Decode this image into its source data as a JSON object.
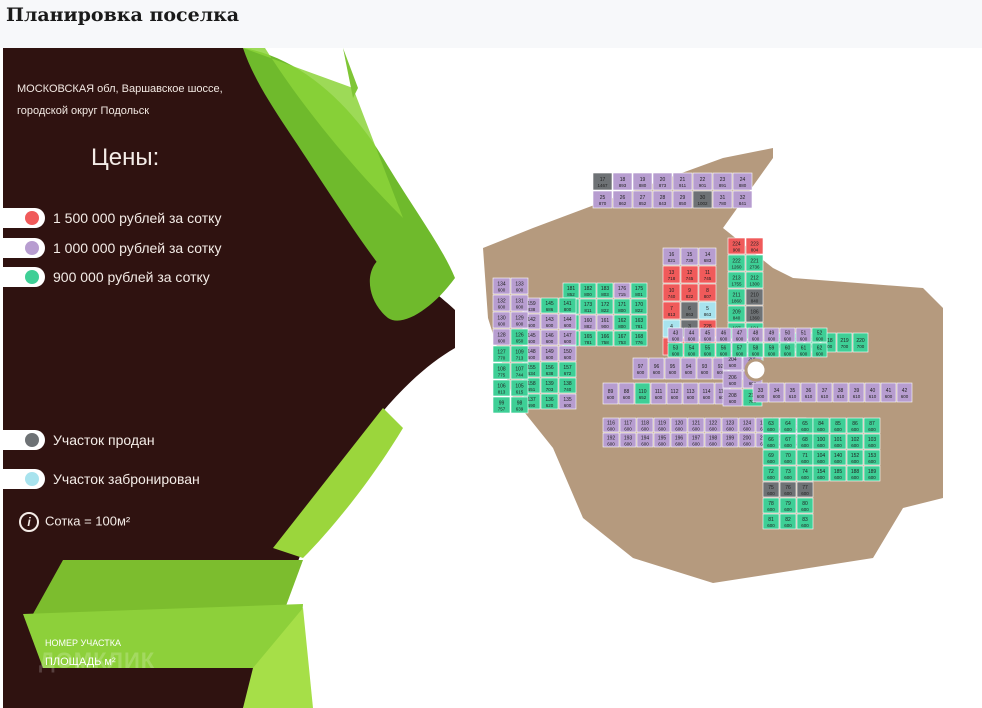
{
  "page_title": "Планировка поселка",
  "address": [
    "МОСКОВСКАЯ обл, Варшавское шоссе,",
    "городской округ Подольск"
  ],
  "prices_title": "Цены:",
  "legend": [
    {
      "label": "1 500 000 рублей за сотку",
      "color": "#f05a5a"
    },
    {
      "label": "1 000 000 рублей за сотку",
      "color": "#b79dd0"
    },
    {
      "label": "900 000 рублей за сотку",
      "color": "#3ecf96"
    },
    {
      "label": "Участок продан",
      "color": "#6e7275"
    },
    {
      "label": "Участок забронирован",
      "color": "#a8e3ee"
    }
  ],
  "sotka_label": "Сотка = 100м²",
  "info_icon": "i",
  "number_label": "НОМЕР УЧАСТКА",
  "area_label": "ПЛОЩАДЬ м²",
  "watermark": "ДОМКЛИК",
  "plot_colors": {
    "red": "#f05a5a",
    "lilac": "#b79dd0",
    "green": "#3ecf96",
    "sold": "#6e7275",
    "reserved": "#a8e3ee",
    "road": "#b59a7e"
  },
  "plots": [
    {
      "id": "17",
      "area": "1467",
      "c": "sold"
    },
    {
      "id": "18",
      "area": "893",
      "c": "lilac"
    },
    {
      "id": "19",
      "area": "880",
      "c": "lilac"
    },
    {
      "id": "20",
      "area": "873",
      "c": "lilac"
    },
    {
      "id": "21",
      "area": "911",
      "c": "lilac"
    },
    {
      "id": "22",
      "area": "901",
      "c": "lilac"
    },
    {
      "id": "23",
      "area": "891",
      "c": "lilac"
    },
    {
      "id": "24",
      "area": "880",
      "c": "lilac"
    },
    {
      "id": "25",
      "area": "870",
      "c": "lilac"
    },
    {
      "id": "26",
      "area": "862",
      "c": "lilac"
    },
    {
      "id": "27",
      "area": "852",
      "c": "lilac"
    },
    {
      "id": "28",
      "area": "843",
      "c": "lilac"
    },
    {
      "id": "29",
      "area": "850",
      "c": "lilac"
    },
    {
      "id": "30",
      "area": "1002",
      "c": "sold"
    },
    {
      "id": "31",
      "area": "780",
      "c": "lilac"
    },
    {
      "id": "32",
      "area": "841",
      "c": "lilac"
    },
    {
      "id": "16",
      "area": "821",
      "c": "lilac"
    },
    {
      "id": "15",
      "area": "739",
      "c": "lilac"
    },
    {
      "id": "14",
      "area": "683",
      "c": "lilac"
    },
    {
      "id": "13",
      "area": "718",
      "c": "red"
    },
    {
      "id": "12",
      "area": "745",
      "c": "red"
    },
    {
      "id": "11",
      "area": "745",
      "c": "red"
    },
    {
      "id": "10",
      "area": "740",
      "c": "red"
    },
    {
      "id": "9",
      "area": "822",
      "c": "red"
    },
    {
      "id": "8",
      "area": "807",
      "c": "red"
    },
    {
      "id": "7",
      "area": "813",
      "c": "red"
    },
    {
      "id": "6",
      "area": "863",
      "c": "sold"
    },
    {
      "id": "5",
      "area": "863",
      "c": "reserved"
    },
    {
      "id": "4",
      "area": "788",
      "c": "reserved"
    },
    {
      "id": "3",
      "area": "660",
      "c": "sold"
    },
    {
      "id": "228",
      "area": "783",
      "c": "red"
    },
    {
      "id": "227",
      "area": "790",
      "c": "red"
    },
    {
      "id": "226",
      "area": "665",
      "c": "red"
    },
    {
      "id": "225",
      "area": "1067",
      "c": "red"
    },
    {
      "id": "224",
      "area": "900",
      "c": "red"
    },
    {
      "id": "223",
      "area": "804",
      "c": "red"
    },
    {
      "id": "222",
      "area": "1260",
      "c": "green"
    },
    {
      "id": "221",
      "area": "2736",
      "c": "green"
    },
    {
      "id": "213",
      "area": "1755",
      "c": "green"
    },
    {
      "id": "212",
      "area": "1300",
      "c": "green"
    },
    {
      "id": "211",
      "area": "1860",
      "c": "green"
    },
    {
      "id": "210",
      "area": "840",
      "c": "sold"
    },
    {
      "id": "209",
      "area": "840",
      "c": "green"
    },
    {
      "id": "186",
      "area": "1360",
      "c": "sold"
    },
    {
      "id": "187",
      "area": "1237",
      "c": "green"
    },
    {
      "id": "184",
      "area": "1185",
      "c": "green"
    },
    {
      "id": "177",
      "area": "2036",
      "c": "lilac"
    },
    {
      "id": "178",
      "area": "1216",
      "c": "green"
    },
    {
      "id": "179",
      "area": "1052",
      "c": "green"
    },
    {
      "id": "180",
      "area": "880",
      "c": "green"
    },
    {
      "id": "181",
      "area": "852",
      "c": "green"
    },
    {
      "id": "182",
      "area": "800",
      "c": "green"
    },
    {
      "id": "183",
      "area": "803",
      "c": "green"
    },
    {
      "id": "176",
      "area": "715",
      "c": "lilac"
    },
    {
      "id": "175",
      "area": "801",
      "c": "green"
    },
    {
      "id": "174",
      "area": "850",
      "c": "green"
    },
    {
      "id": "173",
      "area": "811",
      "c": "green"
    },
    {
      "id": "172",
      "area": "822",
      "c": "green"
    },
    {
      "id": "171",
      "area": "800",
      "c": "green"
    },
    {
      "id": "170",
      "area": "822",
      "c": "green"
    },
    {
      "id": "169",
      "area": "844",
      "c": "green"
    },
    {
      "id": "160",
      "area": "882",
      "c": "lilac"
    },
    {
      "id": "161",
      "area": "900",
      "c": "lilac"
    },
    {
      "id": "162",
      "area": "800",
      "c": "green"
    },
    {
      "id": "163",
      "area": "781",
      "c": "green"
    },
    {
      "id": "164",
      "area": "783",
      "c": "green"
    },
    {
      "id": "165",
      "area": "781",
      "c": "green"
    },
    {
      "id": "166",
      "area": "758",
      "c": "green"
    },
    {
      "id": "167",
      "area": "753",
      "c": "green"
    },
    {
      "id": "168",
      "area": "776",
      "c": "green"
    },
    {
      "id": "159",
      "area": "838",
      "c": "lilac"
    },
    {
      "id": "145",
      "area": "686",
      "c": "green"
    },
    {
      "id": "141",
      "area": "800",
      "c": "green"
    },
    {
      "id": "142",
      "area": "600",
      "c": "lilac"
    },
    {
      "id": "143",
      "area": "600",
      "c": "lilac"
    },
    {
      "id": "144",
      "area": "600",
      "c": "lilac"
    },
    {
      "id": "145b",
      "area": "600",
      "c": "lilac"
    },
    {
      "id": "146",
      "area": "600",
      "c": "lilac"
    },
    {
      "id": "147",
      "area": "600",
      "c": "lilac"
    },
    {
      "id": "148",
      "area": "600",
      "c": "lilac"
    },
    {
      "id": "149",
      "area": "600",
      "c": "lilac"
    },
    {
      "id": "150",
      "area": "600",
      "c": "lilac"
    },
    {
      "id": "155",
      "area": "634",
      "c": "green"
    },
    {
      "id": "156",
      "area": "638",
      "c": "green"
    },
    {
      "id": "157",
      "area": "672",
      "c": "green"
    },
    {
      "id": "158",
      "area": "651",
      "c": "green"
    },
    {
      "id": "139",
      "area": "703",
      "c": "green"
    },
    {
      "id": "138",
      "area": "740",
      "c": "green"
    },
    {
      "id": "137",
      "area": "690",
      "c": "green"
    },
    {
      "id": "136",
      "area": "620",
      "c": "green"
    },
    {
      "id": "135",
      "area": "600",
      "c": "lilac"
    },
    {
      "id": "134",
      "area": "600",
      "c": "lilac"
    },
    {
      "id": "133",
      "area": "600",
      "c": "lilac"
    },
    {
      "id": "132",
      "area": "600",
      "c": "lilac"
    },
    {
      "id": "131",
      "area": "600",
      "c": "lilac"
    },
    {
      "id": "130",
      "area": "600",
      "c": "lilac"
    },
    {
      "id": "129",
      "area": "600",
      "c": "lilac"
    },
    {
      "id": "128",
      "area": "600",
      "c": "lilac"
    },
    {
      "id": "126",
      "area": "650",
      "c": "green"
    },
    {
      "id": "127",
      "area": "770",
      "c": "green"
    },
    {
      "id": "109",
      "area": "713",
      "c": "green"
    },
    {
      "id": "108",
      "area": "775",
      "c": "green"
    },
    {
      "id": "107",
      "area": "744",
      "c": "green"
    },
    {
      "id": "106",
      "area": "813",
      "c": "green"
    },
    {
      "id": "105",
      "area": "615",
      "c": "green"
    },
    {
      "id": "99",
      "area": "757",
      "c": "green"
    },
    {
      "id": "98",
      "area": "639",
      "c": "green"
    },
    {
      "id": "97",
      "area": "600",
      "c": "lilac"
    },
    {
      "id": "96",
      "area": "600",
      "c": "lilac"
    },
    {
      "id": "95",
      "area": "600",
      "c": "lilac"
    },
    {
      "id": "94",
      "area": "600",
      "c": "lilac"
    },
    {
      "id": "93",
      "area": "600",
      "c": "lilac"
    },
    {
      "id": "92",
      "area": "600",
      "c": "lilac"
    },
    {
      "id": "91",
      "area": "600",
      "c": "lilac"
    },
    {
      "id": "90",
      "area": "600",
      "c": "lilac"
    },
    {
      "id": "89",
      "area": "600",
      "c": "lilac"
    },
    {
      "id": "88",
      "area": "600",
      "c": "lilac"
    },
    {
      "id": "110",
      "area": "652",
      "c": "green"
    },
    {
      "id": "111",
      "area": "600",
      "c": "lilac"
    },
    {
      "id": "112",
      "area": "600",
      "c": "lilac"
    },
    {
      "id": "113",
      "area": "600",
      "c": "lilac"
    },
    {
      "id": "114",
      "area": "600",
      "c": "lilac"
    },
    {
      "id": "115",
      "area": "600",
      "c": "lilac"
    },
    {
      "id": "116",
      "area": "600",
      "c": "lilac"
    },
    {
      "id": "117",
      "area": "600",
      "c": "lilac"
    },
    {
      "id": "118",
      "area": "600",
      "c": "lilac"
    },
    {
      "id": "119",
      "area": "600",
      "c": "lilac"
    },
    {
      "id": "120",
      "area": "600",
      "c": "lilac"
    },
    {
      "id": "121",
      "area": "600",
      "c": "lilac"
    },
    {
      "id": "122",
      "area": "600",
      "c": "lilac"
    },
    {
      "id": "123",
      "area": "600",
      "c": "lilac"
    },
    {
      "id": "124",
      "area": "600",
      "c": "lilac"
    },
    {
      "id": "125",
      "area": "600",
      "c": "lilac"
    },
    {
      "id": "190",
      "area": "861",
      "c": "lilac"
    },
    {
      "id": "191",
      "area": "600",
      "c": "lilac"
    },
    {
      "id": "192",
      "area": "600",
      "c": "lilac"
    },
    {
      "id": "193",
      "area": "600",
      "c": "lilac"
    },
    {
      "id": "194",
      "area": "600",
      "c": "lilac"
    },
    {
      "id": "195",
      "area": "600",
      "c": "lilac"
    },
    {
      "id": "196",
      "area": "600",
      "c": "lilac"
    },
    {
      "id": "197",
      "area": "600",
      "c": "lilac"
    },
    {
      "id": "198",
      "area": "600",
      "c": "lilac"
    },
    {
      "id": "199",
      "area": "600",
      "c": "lilac"
    },
    {
      "id": "200",
      "area": "600",
      "c": "lilac"
    },
    {
      "id": "201",
      "area": "600",
      "c": "lilac"
    },
    {
      "id": "202",
      "area": "600",
      "c": "lilac"
    },
    {
      "id": "203",
      "area": "600",
      "c": "lilac"
    },
    {
      "id": "204",
      "area": "600",
      "c": "lilac"
    },
    {
      "id": "205",
      "area": "600",
      "c": "lilac"
    },
    {
      "id": "206",
      "area": "600",
      "c": "lilac"
    },
    {
      "id": "207",
      "area": "600",
      "c": "lilac"
    },
    {
      "id": "208",
      "area": "600",
      "c": "lilac"
    },
    {
      "id": "214",
      "area": "700",
      "c": "green"
    },
    {
      "id": "215",
      "area": "700",
      "c": "green"
    },
    {
      "id": "216",
      "area": "700",
      "c": "green"
    },
    {
      "id": "217",
      "area": "700",
      "c": "green"
    },
    {
      "id": "218",
      "area": "700",
      "c": "green"
    },
    {
      "id": "219",
      "area": "700",
      "c": "green"
    },
    {
      "id": "220",
      "area": "700",
      "c": "green"
    },
    {
      "id": "33",
      "area": "600",
      "c": "lilac"
    },
    {
      "id": "34",
      "area": "600",
      "c": "lilac"
    },
    {
      "id": "35",
      "area": "610",
      "c": "lilac"
    },
    {
      "id": "36",
      "area": "610",
      "c": "lilac"
    },
    {
      "id": "37",
      "area": "610",
      "c": "lilac"
    },
    {
      "id": "38",
      "area": "610",
      "c": "lilac"
    },
    {
      "id": "39",
      "area": "610",
      "c": "lilac"
    },
    {
      "id": "40",
      "area": "610",
      "c": "lilac"
    },
    {
      "id": "41",
      "area": "600",
      "c": "lilac"
    },
    {
      "id": "42",
      "area": "600",
      "c": "lilac"
    },
    {
      "id": "43",
      "area": "600",
      "c": "lilac"
    },
    {
      "id": "44",
      "area": "600",
      "c": "lilac"
    },
    {
      "id": "45",
      "area": "600",
      "c": "lilac"
    },
    {
      "id": "46",
      "area": "600",
      "c": "lilac"
    },
    {
      "id": "47",
      "area": "600",
      "c": "lilac"
    },
    {
      "id": "48",
      "area": "600",
      "c": "lilac"
    },
    {
      "id": "49",
      "area": "600",
      "c": "lilac"
    },
    {
      "id": "50",
      "area": "600",
      "c": "lilac"
    },
    {
      "id": "51",
      "area": "600",
      "c": "lilac"
    },
    {
      "id": "52",
      "area": "600",
      "c": "green"
    },
    {
      "id": "53",
      "area": "600",
      "c": "green"
    },
    {
      "id": "54",
      "area": "600",
      "c": "green"
    },
    {
      "id": "55",
      "area": "600",
      "c": "green"
    },
    {
      "id": "56",
      "area": "600",
      "c": "green"
    },
    {
      "id": "57",
      "area": "600",
      "c": "green"
    },
    {
      "id": "58",
      "area": "600",
      "c": "green"
    },
    {
      "id": "59",
      "area": "600",
      "c": "green"
    },
    {
      "id": "60",
      "area": "600",
      "c": "green"
    },
    {
      "id": "61",
      "area": "600",
      "c": "green"
    },
    {
      "id": "62",
      "area": "600",
      "c": "green"
    },
    {
      "id": "63",
      "area": "600",
      "c": "green"
    },
    {
      "id": "64",
      "area": "600",
      "c": "green"
    },
    {
      "id": "65",
      "area": "600",
      "c": "green"
    },
    {
      "id": "66",
      "area": "600",
      "c": "green"
    },
    {
      "id": "67",
      "area": "600",
      "c": "green"
    },
    {
      "id": "68",
      "area": "600",
      "c": "green"
    },
    {
      "id": "69",
      "area": "600",
      "c": "green"
    },
    {
      "id": "70",
      "area": "600",
      "c": "green"
    },
    {
      "id": "71",
      "area": "600",
      "c": "green"
    },
    {
      "id": "72",
      "area": "600",
      "c": "green"
    },
    {
      "id": "73",
      "area": "600",
      "c": "green"
    },
    {
      "id": "74",
      "area": "600",
      "c": "green"
    },
    {
      "id": "75",
      "area": "600",
      "c": "sold"
    },
    {
      "id": "76",
      "area": "600",
      "c": "sold"
    },
    {
      "id": "77",
      "area": "600",
      "c": "sold"
    },
    {
      "id": "78",
      "area": "600",
      "c": "green"
    },
    {
      "id": "79",
      "area": "600",
      "c": "green"
    },
    {
      "id": "80",
      "area": "600",
      "c": "green"
    },
    {
      "id": "81",
      "area": "600",
      "c": "green"
    },
    {
      "id": "82",
      "area": "600",
      "c": "green"
    },
    {
      "id": "83",
      "area": "600",
      "c": "green"
    },
    {
      "id": "84",
      "area": "600",
      "c": "green"
    },
    {
      "id": "85",
      "area": "600",
      "c": "green"
    },
    {
      "id": "86",
      "area": "600",
      "c": "green"
    },
    {
      "id": "87",
      "area": "600",
      "c": "green"
    },
    {
      "id": "100",
      "area": "600",
      "c": "green"
    },
    {
      "id": "101",
      "area": "600",
      "c": "green"
    },
    {
      "id": "102",
      "area": "600",
      "c": "green"
    },
    {
      "id": "103",
      "area": "600",
      "c": "green"
    },
    {
      "id": "104",
      "area": "600",
      "c": "green"
    },
    {
      "id": "140",
      "area": "600",
      "c": "green"
    },
    {
      "id": "152",
      "area": "600",
      "c": "green"
    },
    {
      "id": "153",
      "area": "600",
      "c": "green"
    },
    {
      "id": "154",
      "area": "600",
      "c": "green"
    },
    {
      "id": "185",
      "area": "600",
      "c": "green"
    },
    {
      "id": "188",
      "area": "600",
      "c": "green"
    },
    {
      "id": "189",
      "area": "600",
      "c": "green"
    }
  ]
}
